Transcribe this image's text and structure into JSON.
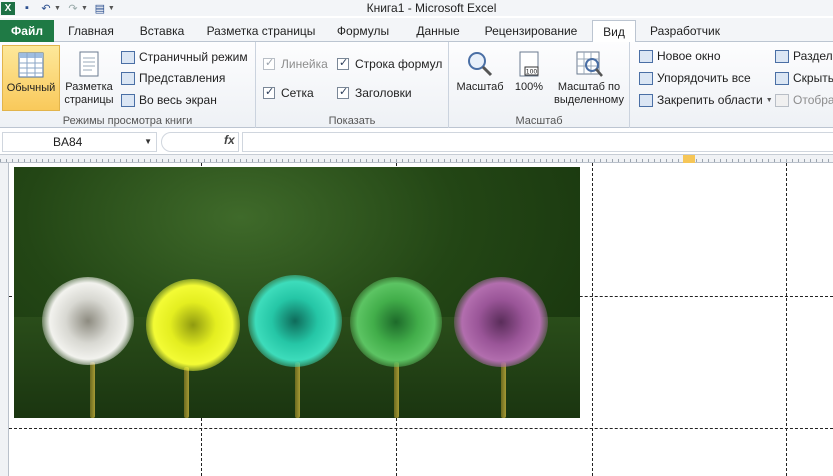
{
  "window": {
    "title": "Книга1  -  Microsoft Excel"
  },
  "tabs": [
    {
      "label": "Файл"
    },
    {
      "label": "Главная"
    },
    {
      "label": "Вставка"
    },
    {
      "label": "Разметка страницы"
    },
    {
      "label": "Формулы"
    },
    {
      "label": "Данные"
    },
    {
      "label": "Рецензирование"
    },
    {
      "label": "Вид"
    },
    {
      "label": "Разработчик"
    }
  ],
  "ribbon": {
    "views_group": {
      "label": "Режимы просмотра книги",
      "normal": "Обычный",
      "page_layout": "Разметка страницы",
      "page_break": "Страничный режим",
      "custom_views": "Представления",
      "full_screen": "Во весь экран"
    },
    "show_group": {
      "label": "Показать",
      "ruler": "Линейка",
      "formula_bar": "Строка формул",
      "gridlines": "Сетка",
      "headings": "Заголовки"
    },
    "zoom_group": {
      "label": "Масштаб",
      "zoom": "Масштаб",
      "zoom100": "100%",
      "zoom_selection": "Масштаб по выделенному"
    },
    "window_group": {
      "new_window": "Новое окно",
      "arrange_all": "Упорядочить все",
      "freeze_panes": "Закрепить области",
      "split": "Раздели",
      "hide": "Скрыть",
      "unhide": "Отобра"
    }
  },
  "formula_bar": {
    "name_box": "BA84",
    "fx": "fx",
    "value": ""
  },
  "colors": {
    "file_tab": "#1f7a45",
    "selected_button": "#f9c95b"
  }
}
